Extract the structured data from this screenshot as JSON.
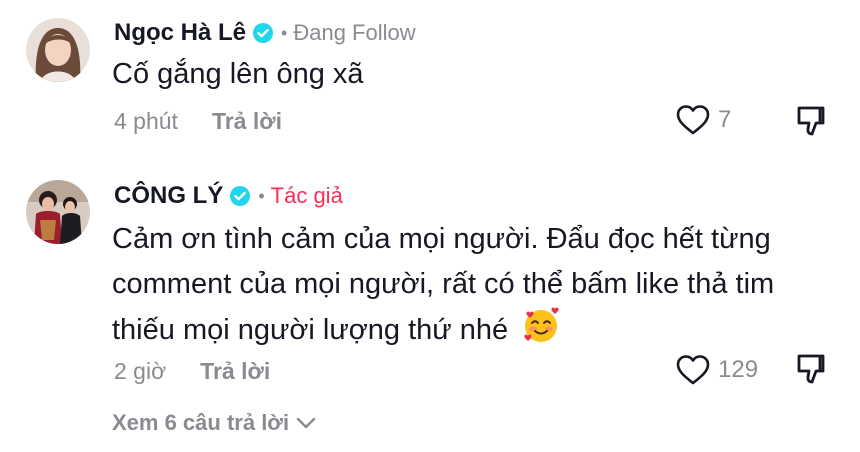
{
  "comments": [
    {
      "author": "Ngọc Hà Lê",
      "status": "Đang Follow",
      "text_lines": [
        "Cố gắng lên ông xã"
      ],
      "time": "4 phút",
      "reply_label": "Trả lời",
      "likes": "7"
    },
    {
      "author": "CÔNG LÝ",
      "tag": "Tác giả",
      "text_lines": [
        "Cảm ơn tình cảm của mọi người. Đẩu đọc hết từng",
        "comment của mọi người, rất có thể bấm like thả tim",
        "thiếu mọi người lượng thứ nhé"
      ],
      "time": "2 giờ",
      "reply_label": "Trả lời",
      "likes": "129"
    }
  ],
  "view_replies_label": "Xem 6 câu trả lời",
  "colors": {
    "accent": "#fe2c55",
    "verified": "#20d5ec",
    "muted": "#8a8b91",
    "text": "#161823"
  },
  "icons": [
    "verified-badge-icon",
    "heart-icon",
    "dislike-icon",
    "chevron-down-icon",
    "smiling-face-with-hearts-emoji"
  ]
}
